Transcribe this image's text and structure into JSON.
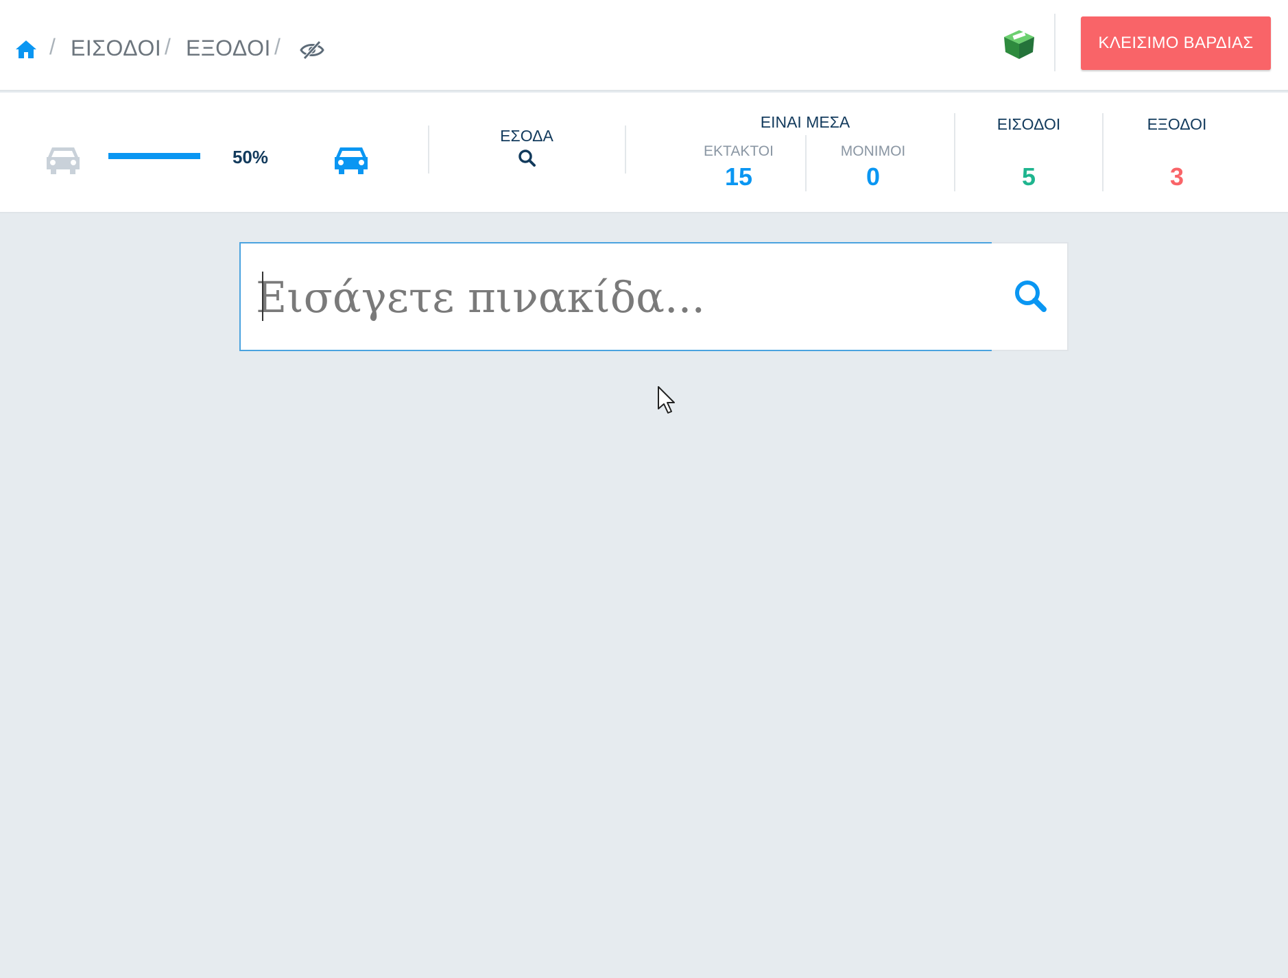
{
  "header": {
    "breadcrumbs": [
      "ΕΙΣΟΔΟΙ",
      "ΕΞΟΔΟΙ"
    ],
    "separator": "/",
    "close_shift_label": "ΚΛΕΙΣΙΜΟ ΒΑΡΔΙΑΣ",
    "icons": [
      "home-icon",
      "eye-slash-icon",
      "cash-register-icon"
    ]
  },
  "stats": {
    "occupancy_percent": "50%",
    "occupancy_fraction": 0.5,
    "revenue_title": "ΕΣΟΔΑ",
    "inside_title": "ΕΙΝΑΙ ΜΕΣΑ",
    "occasional_label": "ΕΚΤΑΚΤΟΙ",
    "occasional_value": "15",
    "permanent_label": "ΜΟΝΙΜΟΙ",
    "permanent_value": "0",
    "entries_title": "ΕΙΣΟΔΟΙ",
    "entries_value": "5",
    "exits_title": "ΕΞΟΔΟΙ",
    "exits_value": "3"
  },
  "search": {
    "placeholder": "Εισάγετε πινακίδα..."
  },
  "colors": {
    "accent_blue": "#0a96f2",
    "dark_navy": "#123a5c",
    "entries_green": "#1fb58f",
    "exits_red": "#f96468",
    "close_button": "#f96468"
  }
}
